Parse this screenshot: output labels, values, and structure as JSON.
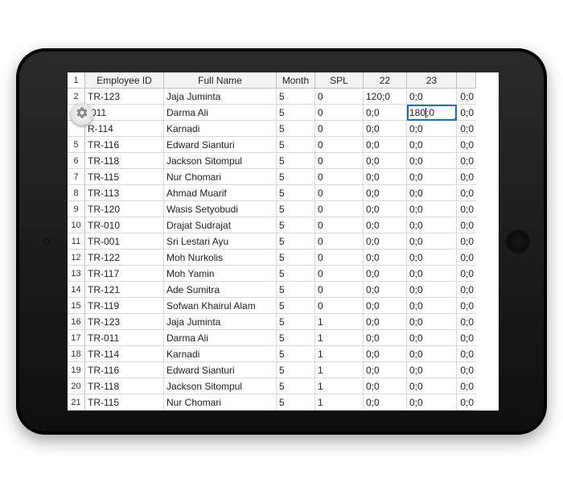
{
  "columns": {
    "rownum_first": "1",
    "emp": "Employee ID",
    "name": "Full Name",
    "month": "Month",
    "spl": "SPL",
    "c22": "22",
    "c23": "23",
    "clast": ""
  },
  "selected": {
    "row_index": 1,
    "col": "c23",
    "value_left": "180",
    "value_right": "0"
  },
  "gear_icon": "gear",
  "rows": [
    {
      "num": "2",
      "emp": "TR-123",
      "name": "Jaja Juminta",
      "month": "5",
      "spl": "0",
      "c22": "120;0",
      "c23": "0;0",
      "clast": "0;0"
    },
    {
      "num": "",
      "emp": "-011",
      "name": "Darma Ali",
      "month": "5",
      "spl": "0",
      "c22": "0;0",
      "c23": "180;0",
      "clast": "0;0"
    },
    {
      "num": "",
      "emp": "R-114",
      "name": "Karnadi",
      "month": "5",
      "spl": "0",
      "c22": "0;0",
      "c23": "0;0",
      "clast": "0;0"
    },
    {
      "num": "5",
      "emp": "TR-116",
      "name": "Edward Sianturi",
      "month": "5",
      "spl": "0",
      "c22": "0;0",
      "c23": "0;0",
      "clast": "0;0"
    },
    {
      "num": "6",
      "emp": "TR-118",
      "name": "Jackson Sitompul",
      "month": "5",
      "spl": "0",
      "c22": "0;0",
      "c23": "0;0",
      "clast": "0;0"
    },
    {
      "num": "7",
      "emp": "TR-115",
      "name": "Nur Chomari",
      "month": "5",
      "spl": "0",
      "c22": "0;0",
      "c23": "0;0",
      "clast": "0;0"
    },
    {
      "num": "8",
      "emp": "TR-113",
      "name": "Ahmad Muarif",
      "month": "5",
      "spl": "0",
      "c22": "0;0",
      "c23": "0;0",
      "clast": "0;0"
    },
    {
      "num": "9",
      "emp": "TR-120",
      "name": "Wasis Setyobudi",
      "month": "5",
      "spl": "0",
      "c22": "0;0",
      "c23": "0;0",
      "clast": "0;0"
    },
    {
      "num": "10",
      "emp": "TR-010",
      "name": "Drajat Sudrajat",
      "month": "5",
      "spl": "0",
      "c22": "0;0",
      "c23": "0;0",
      "clast": "0;0"
    },
    {
      "num": "11",
      "emp": "TR-001",
      "name": "Sri Lestari Ayu",
      "month": "5",
      "spl": "0",
      "c22": "0;0",
      "c23": "0;0",
      "clast": "0;0"
    },
    {
      "num": "12",
      "emp": "TR-122",
      "name": "Moh Nurkolis",
      "month": "5",
      "spl": "0",
      "c22": "0;0",
      "c23": "0;0",
      "clast": "0;0"
    },
    {
      "num": "13",
      "emp": "TR-117",
      "name": "Moh Yamin",
      "month": "5",
      "spl": "0",
      "c22": "0;0",
      "c23": "0;0",
      "clast": "0;0"
    },
    {
      "num": "14",
      "emp": "TR-121",
      "name": "Ade Sumitra",
      "month": "5",
      "spl": "0",
      "c22": "0;0",
      "c23": "0;0",
      "clast": "0;0"
    },
    {
      "num": "15",
      "emp": "TR-119",
      "name": "Sofwan Khairul Alam",
      "month": "5",
      "spl": "0",
      "c22": "0;0",
      "c23": "0;0",
      "clast": "0;0"
    },
    {
      "num": "16",
      "emp": "TR-123",
      "name": "Jaja Juminta",
      "month": "5",
      "spl": "1",
      "c22": "0;0",
      "c23": "0;0",
      "clast": "0;0"
    },
    {
      "num": "17",
      "emp": "TR-011",
      "name": "Darma Ali",
      "month": "5",
      "spl": "1",
      "c22": "0;0",
      "c23": "0;0",
      "clast": "0;0"
    },
    {
      "num": "18",
      "emp": "TR-114",
      "name": "Karnadi",
      "month": "5",
      "spl": "1",
      "c22": "0;0",
      "c23": "0;0",
      "clast": "0;0"
    },
    {
      "num": "19",
      "emp": "TR-116",
      "name": "Edward Sianturi",
      "month": "5",
      "spl": "1",
      "c22": "0;0",
      "c23": "0;0",
      "clast": "0;0"
    },
    {
      "num": "20",
      "emp": "TR-118",
      "name": "Jackson Sitompul",
      "month": "5",
      "spl": "1",
      "c22": "0;0",
      "c23": "0;0",
      "clast": "0;0"
    },
    {
      "num": "21",
      "emp": "TR-115",
      "name": "Nur Chomari",
      "month": "5",
      "spl": "1",
      "c22": "0;0",
      "c23": "0;0",
      "clast": "0;0"
    }
  ]
}
